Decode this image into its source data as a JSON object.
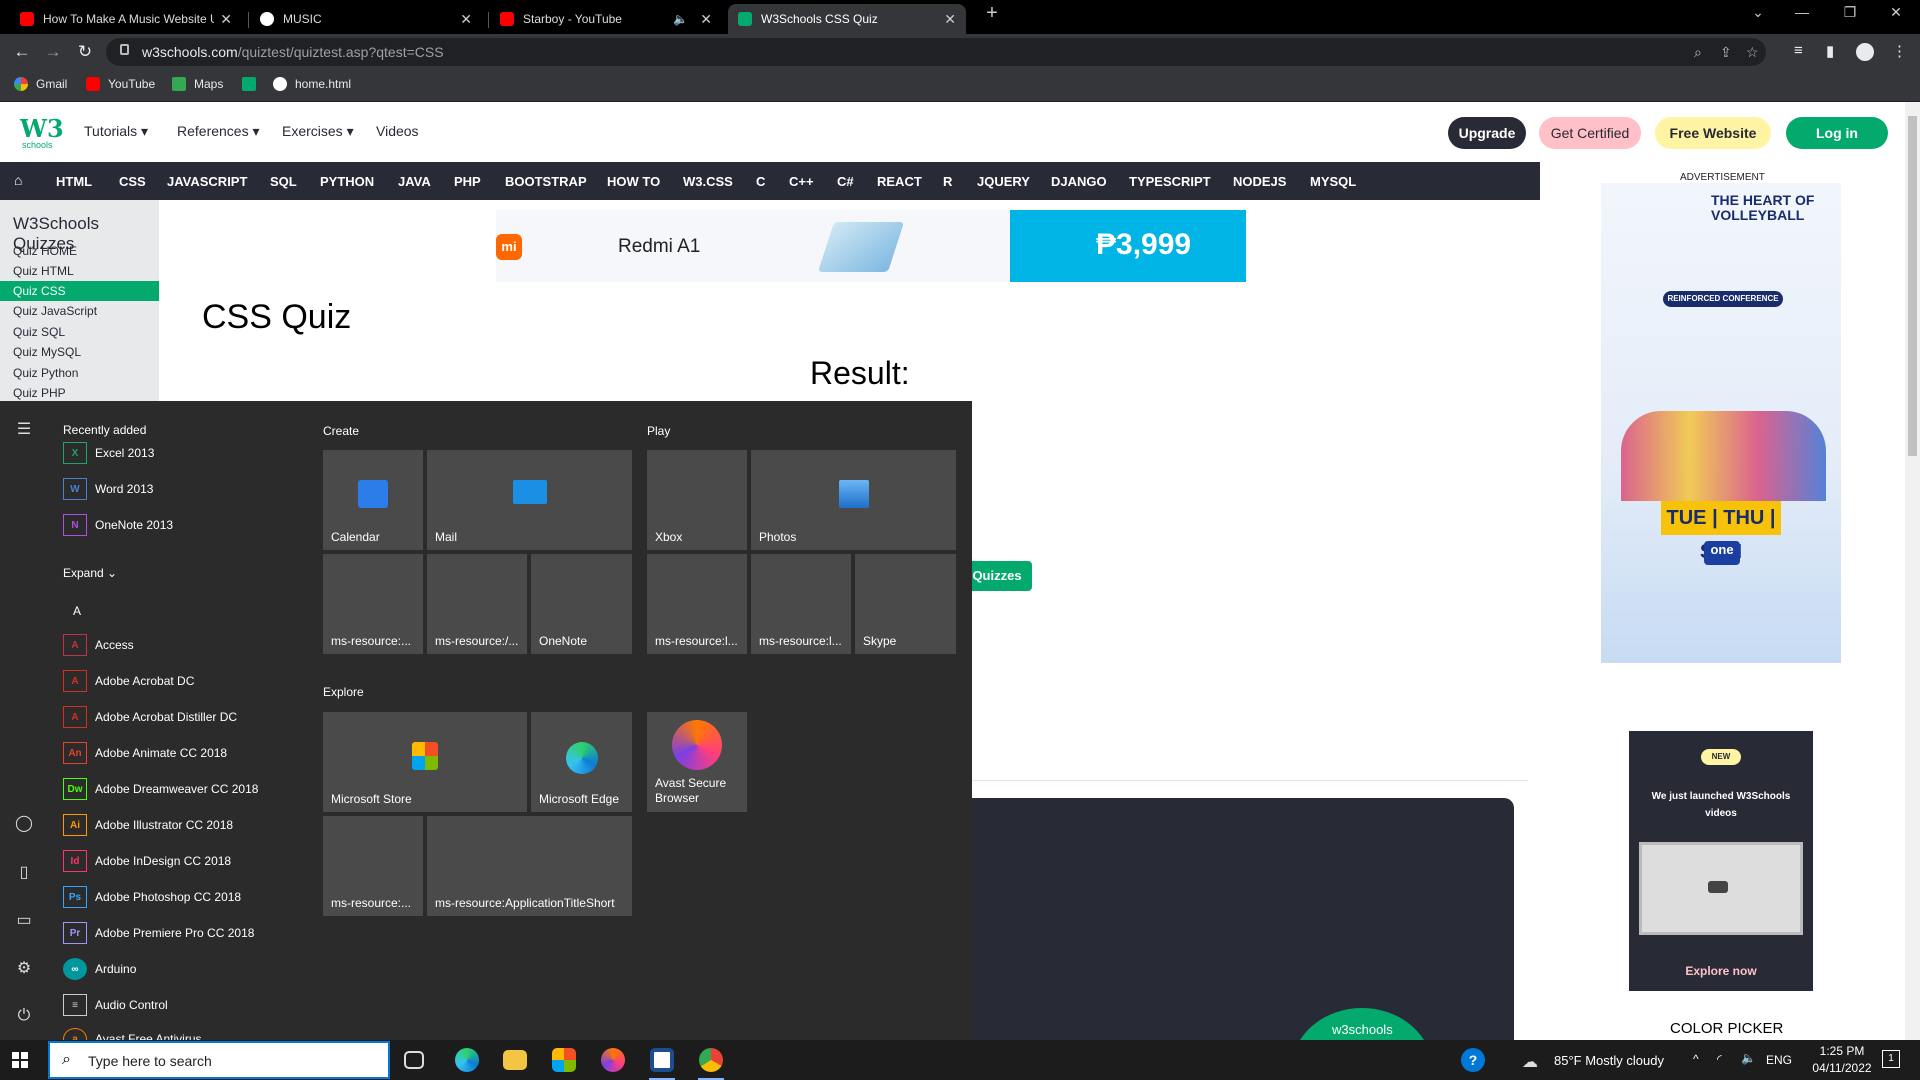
{
  "browser": {
    "tabs": [
      {
        "title": "How To Make A Music Website U",
        "icon": "youtube-icon"
      },
      {
        "title": "MUSIC",
        "icon": "globe-icon"
      },
      {
        "title": "Starboy - YouTube",
        "icon": "youtube-icon"
      },
      {
        "title": "W3Schools CSS Quiz",
        "icon": "w3schools-icon"
      }
    ],
    "url_host": "w3schools.com",
    "url_path": "/quiztest/quiztest.asp?qtest=CSS",
    "bookmarks": [
      "Gmail",
      "YouTube",
      "Maps",
      "home.html"
    ]
  },
  "w3": {
    "logo_text": "W3",
    "logo_sub": "schools",
    "nav": [
      "Tutorials",
      "References",
      "Exercises",
      "Videos"
    ],
    "buttons": {
      "upgrade": "Upgrade",
      "certified": "Get Certified",
      "website": "Free Website",
      "login": "Log in"
    },
    "topnav": [
      "HTML",
      "CSS",
      "JAVASCRIPT",
      "SQL",
      "PYTHON",
      "JAVA",
      "PHP",
      "BOOTSTRAP",
      "HOW TO",
      "W3.CSS",
      "C",
      "C++",
      "C#",
      "REACT",
      "R",
      "JQUERY",
      "DJANGO",
      "TYPESCRIPT",
      "NODEJS",
      "MYSQL"
    ],
    "sidebar_title": "W3Schools Quizzes",
    "sidebar": [
      "Quiz HOME",
      "Quiz HTML",
      "Quiz CSS",
      "Quiz JavaScript",
      "Quiz SQL",
      "Quiz MySQL",
      "Quiz Python",
      "Quiz PHP"
    ],
    "ad1": {
      "brand": "mi",
      "product": "Redmi A1",
      "price": "₱3,999"
    },
    "quiz_title": "CSS Quiz",
    "result_label": "Result:",
    "quizzes_button": "Quizzes",
    "advert_label": "ADVERTISEMENT",
    "ad2": {
      "headline": "THE HEART OF VOLLEYBALL",
      "event": "REINFORCED CONFERENCE",
      "days": "TUE | THU | SUN",
      "network": "one"
    },
    "video_card": {
      "badge": "NEW",
      "text": "We just launched W3Schools videos",
      "cta": "Explore now"
    },
    "color_picker": "COLOR PICKER",
    "panel_logo": "w3schools"
  },
  "start_menu": {
    "recently_added": "Recently added",
    "recent": [
      {
        "name": "Excel 2013",
        "abbr": "X",
        "color": "#21a366"
      },
      {
        "name": "Word 2013",
        "abbr": "W",
        "color": "#2b579a"
      },
      {
        "name": "OneNote 2013",
        "abbr": "N",
        "color": "#7719aa"
      }
    ],
    "expand": "Expand",
    "letter": "A",
    "apps": [
      {
        "name": "Access",
        "abbr": "A",
        "color": "#c4314b"
      },
      {
        "name": "Adobe Acrobat DC",
        "abbr": "A",
        "color": "#d92d20"
      },
      {
        "name": "Adobe Acrobat Distiller DC",
        "abbr": "A",
        "color": "#d92d20"
      },
      {
        "name": "Adobe Animate CC 2018",
        "abbr": "An",
        "color": "#e8412a"
      },
      {
        "name": "Adobe Dreamweaver CC 2018",
        "abbr": "Dw",
        "color": "#4aff00"
      },
      {
        "name": "Adobe Illustrator CC 2018",
        "abbr": "Ai",
        "color": "#ff9a00"
      },
      {
        "name": "Adobe InDesign CC 2018",
        "abbr": "Id",
        "color": "#ff3366"
      },
      {
        "name": "Adobe Photoshop CC 2018",
        "abbr": "Ps",
        "color": "#31a8ff"
      },
      {
        "name": "Adobe Premiere Pro CC 2018",
        "abbr": "Pr",
        "color": "#9999ff"
      },
      {
        "name": "Arduino",
        "abbr": "∞",
        "color": "#00979d"
      },
      {
        "name": "Audio Control",
        "abbr": "≡",
        "color": "#cccccc"
      },
      {
        "name": "Avast Free Antivirus",
        "abbr": "a",
        "color": "#ff7800"
      }
    ],
    "groups": {
      "create": "Create",
      "play": "Play",
      "explore": "Explore"
    },
    "tiles": {
      "calendar": "Calendar",
      "mail": "Mail",
      "xbox": "Xbox",
      "photos": "Photos",
      "res1": "ms-resource:...",
      "res2": "ms-resource:/...",
      "onenote": "OneNote",
      "res3": "ms-resource:l...",
      "res4": "ms-resource:l...",
      "skype": "Skype",
      "store": "Microsoft Store",
      "edge": "Microsoft Edge",
      "avast": "Avast Secure Browser",
      "res5": "ms-resource:...",
      "res6": "ms-resource:ApplicationTitleShort"
    }
  },
  "taskbar": {
    "search_placeholder": "Type here to search",
    "weather": "85°F  Mostly cloudy",
    "lang": "ENG",
    "time": "1:25 PM",
    "date": "04/11/2022",
    "notif_count": "1"
  }
}
